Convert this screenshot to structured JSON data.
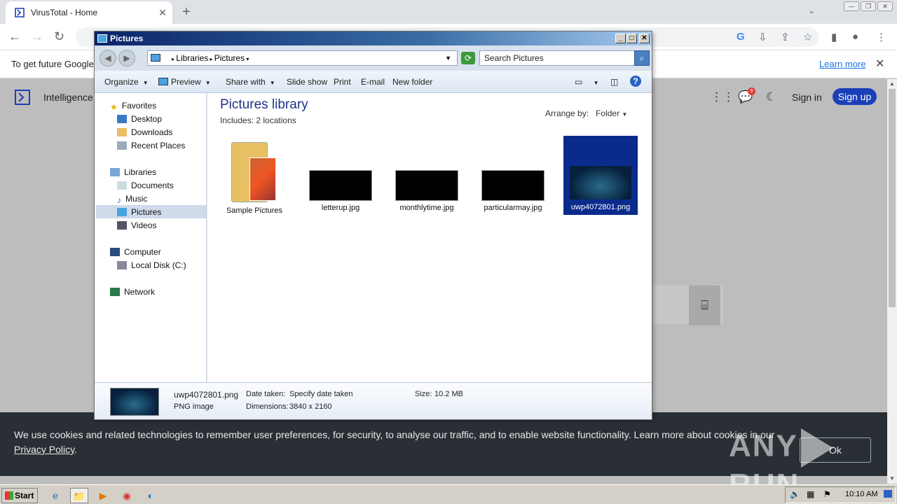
{
  "browser": {
    "tab_title": "VirusTotal - Home",
    "new_tab": "+",
    "info_text": "To get future Google",
    "learn_more": "Learn more"
  },
  "page": {
    "intel_label": "Intelligence",
    "notification_count": "9",
    "sign_in": "Sign in",
    "sign_up": "Sign up"
  },
  "cookie": {
    "text": "We use cookies and related technologies to remember user preferences, for security, to analyse our traffic, and to enable website functionality. Learn more about cookies in our",
    "policy_link": "Privacy Policy",
    "ok_label": "Ok"
  },
  "watermark": {
    "left": "ANY",
    "right": "RUN"
  },
  "explorer": {
    "title": "Pictures",
    "breadcrumb": [
      "Libraries",
      "Pictures"
    ],
    "search_placeholder": "Search Pictures",
    "commands": [
      "Organize",
      "Preview",
      "Share with",
      "Slide show",
      "Print",
      "E-mail",
      "New folder"
    ],
    "nav": {
      "favorites": "Favorites",
      "fav_items": [
        "Desktop",
        "Downloads",
        "Recent Places"
      ],
      "libraries": "Libraries",
      "lib_items": [
        "Documents",
        "Music",
        "Pictures",
        "Videos"
      ],
      "computer": "Computer",
      "computer_items": [
        "Local Disk (C:)"
      ],
      "network": "Network"
    },
    "library_title": "Pictures library",
    "includes_label": "Includes:",
    "includes_value": "2 locations",
    "arrange_label": "Arrange by:",
    "arrange_value": "Folder",
    "files": [
      "Sample Pictures",
      "letterup.jpg",
      "monthlytime.jpg",
      "particularmay.jpg",
      "uwp4072801.png"
    ],
    "details": {
      "name": "uwp4072801.png",
      "type": "PNG image",
      "date_label": "Date taken:",
      "date_value": "Specify date taken",
      "dim_label": "Dimensions:",
      "dim_value": "3840 x 2160",
      "size_label": "Size:",
      "size_value": "10.2 MB"
    }
  },
  "taskbar": {
    "start": "Start",
    "clock": "10:10 AM"
  }
}
